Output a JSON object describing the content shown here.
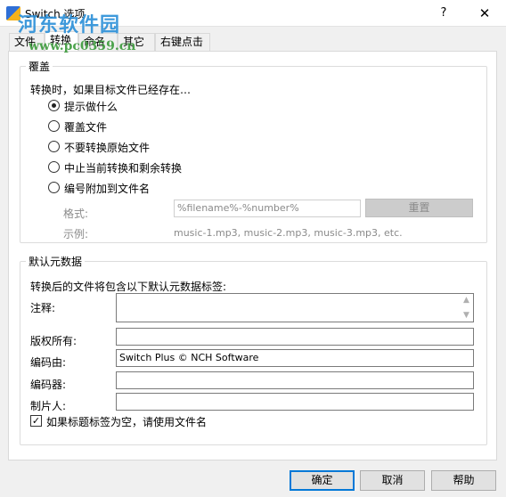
{
  "window": {
    "title": "Switch 选项",
    "help_glyph": "?",
    "close_glyph": "✕"
  },
  "watermark": {
    "line1": "河东软件园",
    "line2": "www.pc0359.cn"
  },
  "tabs": [
    {
      "label": "文件"
    },
    {
      "label": "转换"
    },
    {
      "label": "命名"
    },
    {
      "label": "其它"
    },
    {
      "label": "右键点击"
    }
  ],
  "overwrite": {
    "title": "覆盖",
    "prompt": "转换时，如果目标文件已经存在…",
    "options": [
      {
        "label": "提示做什么",
        "selected": true
      },
      {
        "label": "覆盖文件",
        "selected": false
      },
      {
        "label": "不要转换原始文件",
        "selected": false
      },
      {
        "label": "中止当前转换和剩余转换",
        "selected": false
      },
      {
        "label": "编号附加到文件名",
        "selected": false
      }
    ],
    "format_label": "格式:",
    "format_value": "%filename%-%number%",
    "reset_label": "重置",
    "example_label": "示例:",
    "example_value": "music-1.mp3, music-2.mp3, music-3.mp3, etc."
  },
  "metadata": {
    "title": "默认元数据",
    "intro": "转换后的文件将包含以下默认元数据标签:",
    "comment_label": "注释:",
    "comment_value": "",
    "copyright_label": "版权所有:",
    "copyright_value": "",
    "encoded_by_label": "编码由:",
    "encoded_by_value": "Switch Plus © NCH Software",
    "encoder_label": "编码器:",
    "encoder_value": "",
    "producer_label": "制片人:",
    "producer_value": "",
    "use_filename_checked": true,
    "use_filename_label": "如果标题标签为空，请使用文件名"
  },
  "buttons": {
    "ok": "确定",
    "cancel": "取消",
    "help": "帮助"
  },
  "colors": {
    "accent": "#0078d7",
    "watermark_blue": "#2a8fd8",
    "watermark_green": "#3a9a3a"
  }
}
